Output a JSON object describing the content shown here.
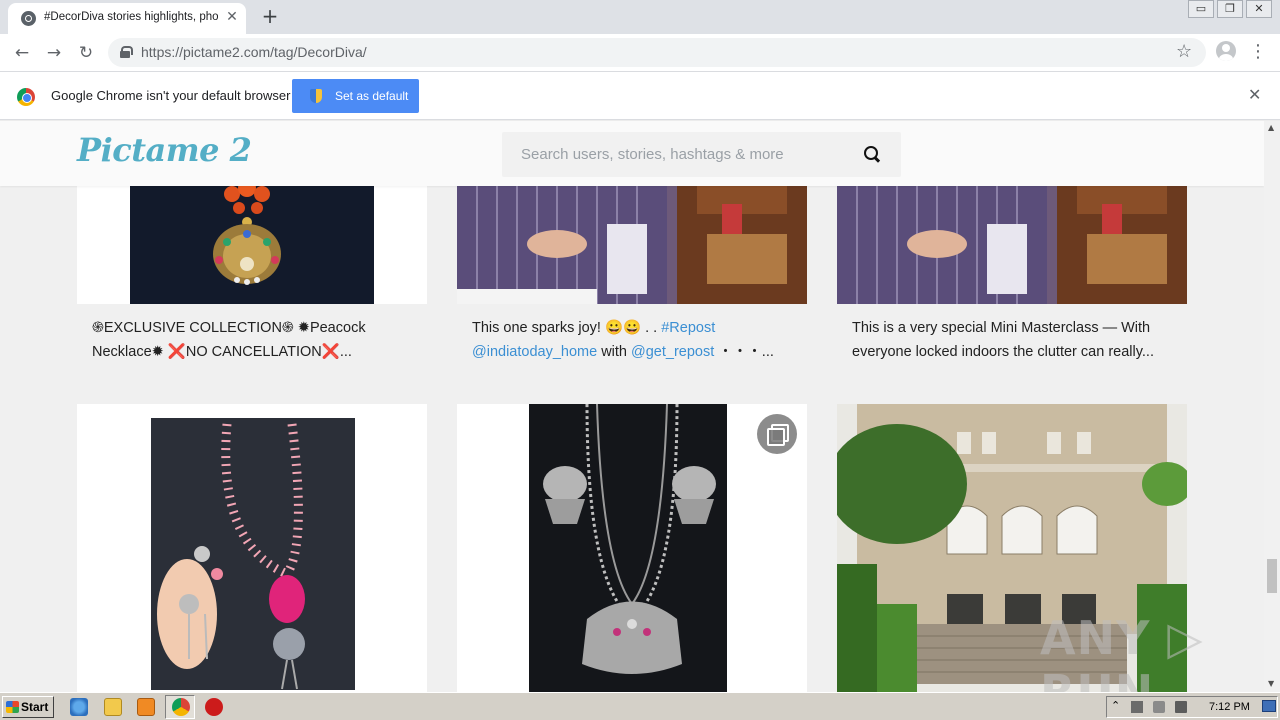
{
  "browser": {
    "tab_title": "#DecorDiva stories highlights, photos",
    "tab_close": "✕",
    "new_tab": "+",
    "url_domain": "https://pictame2.com",
    "url_path": "/tag/DecorDiva/",
    "window_minimize": "▭",
    "window_restore": "❐",
    "window_close": "✕"
  },
  "infobar": {
    "message": "Google Chrome isn't your default browser",
    "button_label": "Set as default",
    "close": "✕"
  },
  "site": {
    "logo": "Pictame 2",
    "search_placeholder": "Search users, stories, hashtags & more"
  },
  "posts": [
    {
      "caption_parts": [
        "֍EXCLUSIVE COLLECTION֍ ✹Peacock Necklace✹ ❌NO CANCELLATION❌..."
      ],
      "image": "peacock-necklace"
    },
    {
      "caption_text_1": "This one sparks joy! 😀😀 . . ",
      "caption_tag_1": "#Repost",
      "caption_tag_2": "@indiatoday_home",
      "caption_text_2": " with ",
      "caption_tag_3": "@get_repost",
      "caption_text_3": " ・・・...",
      "image": "woman-seated"
    },
    {
      "caption_parts": [
        "This is a very special Mini Masterclass — With everyone locked indoors the clutter can really..."
      ],
      "image": "woman-seated"
    },
    {
      "image": "pink-bead-necklace"
    },
    {
      "image": "silver-oxidised-necklace",
      "multi": true
    },
    {
      "image": "stone-mansion"
    }
  ],
  "watermark": "ANY ▷ RUN",
  "taskbar": {
    "start_label": "Start",
    "clock": "7:12 PM"
  },
  "colors": {
    "accent": "#4c8bf5",
    "logo": "#54aec6",
    "link": "#3b8fd3"
  }
}
